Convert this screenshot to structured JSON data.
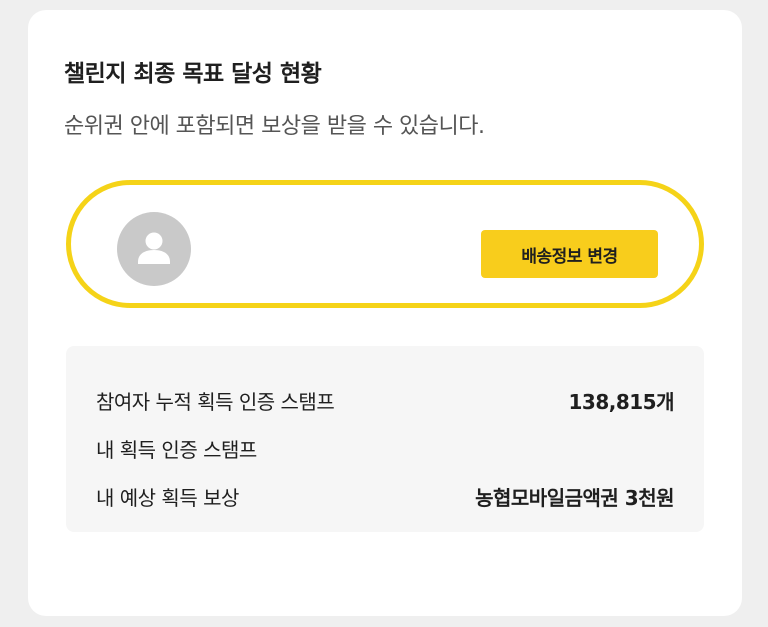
{
  "header": {
    "title": "챌린지 최종 목표 달성 현황",
    "subtitle": "순위권 안에 포함되면 보상을 받을 수 있습니다."
  },
  "user": {
    "avatar_icon": "person-icon",
    "delivery_button_label": "배송정보 변경"
  },
  "stats": {
    "rows": [
      {
        "label": "참여자 누적 획득 인증 스탬프",
        "value": "138,815개"
      },
      {
        "label": "내 획득 인증 스탬프",
        "value": ""
      },
      {
        "label": "내 예상 획득 보상",
        "value": "농협모바일금액권 3천원"
      }
    ]
  },
  "colors": {
    "accent_yellow": "#f8cd1c",
    "border_yellow": "#f5d318",
    "avatar_gray": "#c9c9c9",
    "stats_bg": "#f6f6f6"
  }
}
